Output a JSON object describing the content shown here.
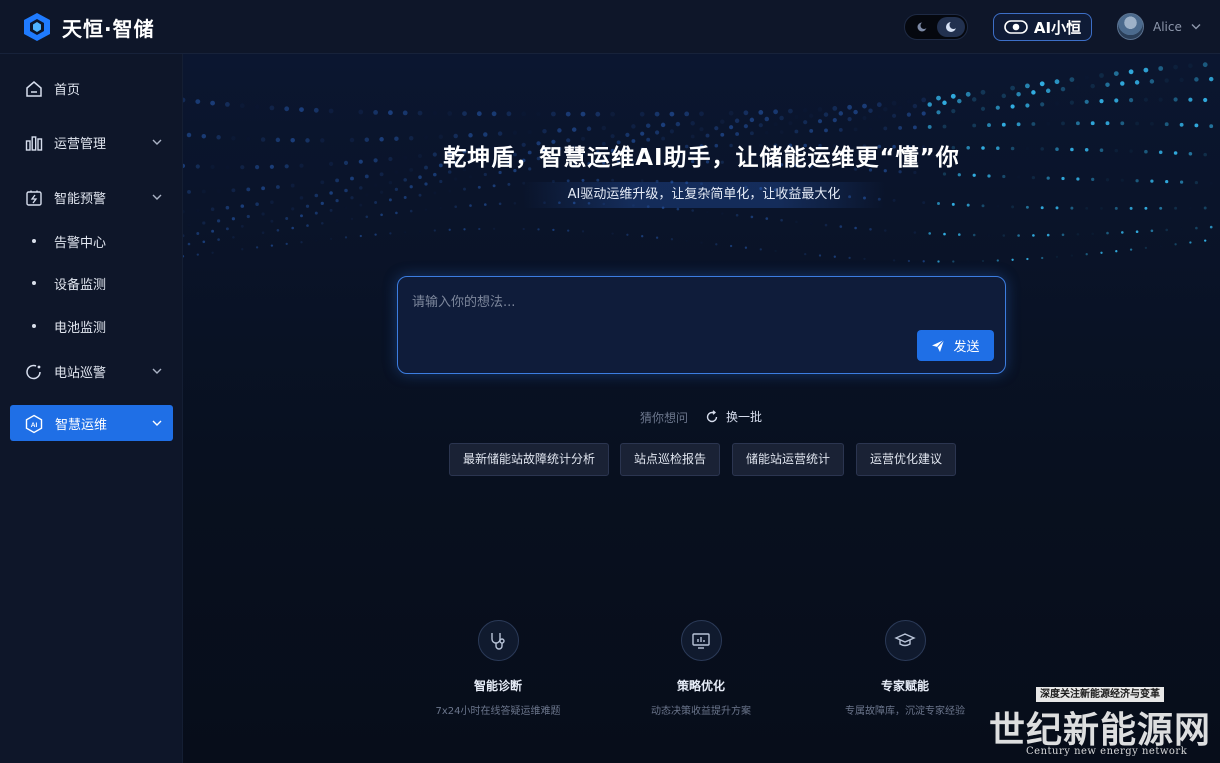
{
  "app": {
    "logo_text": "天恒·智储",
    "ai_button_label": "AI小恒",
    "user_name": "Alice",
    "colors": {
      "primary": "#1f6fe6",
      "bg": "#0b1224",
      "sidebar": "#0e1629"
    }
  },
  "sidebar": {
    "items": [
      {
        "label": "首页",
        "icon": "home-icon",
        "type": "item"
      },
      {
        "label": "运营管理",
        "icon": "bar-chart-icon",
        "type": "group",
        "expanded": false
      },
      {
        "label": "智能预警",
        "icon": "battery-alert-icon",
        "type": "group",
        "expanded": true
      },
      {
        "label": "告警中心",
        "type": "sub"
      },
      {
        "label": "设备监测",
        "type": "sub"
      },
      {
        "label": "电池监测",
        "type": "sub"
      },
      {
        "label": "电站巡警",
        "icon": "patrol-icon",
        "type": "group",
        "expanded": false
      },
      {
        "label": "智慧运维",
        "icon": "ai-icon",
        "type": "group",
        "active": true
      }
    ]
  },
  "hero": {
    "title": "乾坤盾，智慧运维AI助手，让储能运维更“懂”你",
    "subtitle": "AI驱动运维升级，让复杂简单化，让收益最大化"
  },
  "input": {
    "placeholder": "请输入你的想法...",
    "value": "",
    "send_label": "发送"
  },
  "suggestions": {
    "guess_label": "猜你想问",
    "refresh_label": "换一批",
    "chips": [
      "最新储能站故障统计分析",
      "站点巡检报告",
      "储能站运营统计",
      "运营优化建议"
    ]
  },
  "features": [
    {
      "title": "智能诊断",
      "desc": "7x24小时在线答疑运维难题",
      "icon": "stethoscope-icon"
    },
    {
      "title": "策略优化",
      "desc": "动态决策收益提升方案",
      "icon": "monitor-chart-icon"
    },
    {
      "title": "专家赋能",
      "desc": "专属故障库，沉淀专家经验",
      "icon": "graduation-cap-icon"
    }
  ],
  "watermark": {
    "badge": "深度关注新能源经济与变革",
    "main": "世纪新能源网",
    "en": "Century new energy network"
  }
}
